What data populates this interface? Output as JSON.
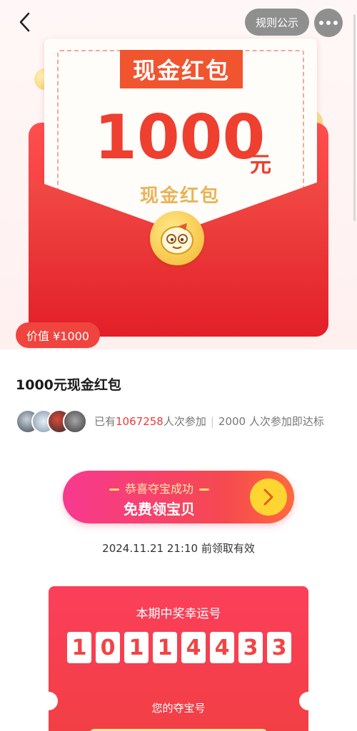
{
  "header": {
    "rules_label": "规则公示"
  },
  "hero": {
    "card_tag": "现金红包",
    "amount": "1000",
    "unit": "元",
    "card_subtitle": "现金红包",
    "value_badge": "价值 ¥1000"
  },
  "prize": {
    "title": "1000元现金红包",
    "participants_prefix": "已有",
    "participants_count": "1067258",
    "participants_suffix": "人次参加",
    "target_text": "2000 人次参加即达标"
  },
  "claim": {
    "line1": "恭喜夺宝成功",
    "line2": "免费领宝贝",
    "expire_text": "2024.11.21 21:10 前领取有效"
  },
  "lucky": {
    "title": "本期中奖幸运号",
    "digits": [
      "1",
      "0",
      "1",
      "1",
      "4",
      "4",
      "3",
      "3"
    ],
    "my_numbers_title": "您的夺宝号"
  },
  "colors": {
    "accent_red": "#f0443f",
    "claim_gradient_start": "#f7398f",
    "claim_gradient_end": "#ff6a3d",
    "arrow_yellow": "#ffd531",
    "highlight_count": "#ee3b3b"
  }
}
